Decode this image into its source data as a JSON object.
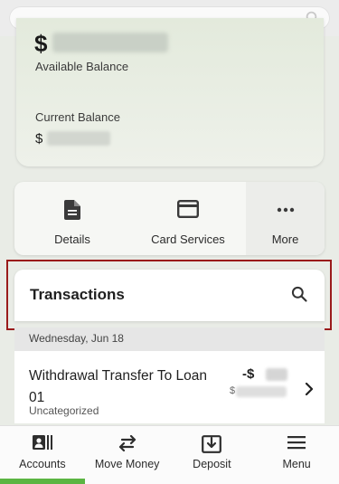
{
  "search": {
    "placeholder": ""
  },
  "balance": {
    "currency_symbol": "$",
    "available_label": "Available Balance",
    "current_label": "Current Balance",
    "current_currency_symbol": "$"
  },
  "actions": [
    {
      "label": "Details",
      "icon": "document-icon"
    },
    {
      "label": "Card Services",
      "icon": "credit-card-icon"
    },
    {
      "label": "More",
      "icon": "more-dots-icon"
    }
  ],
  "transactions": {
    "title": "Transactions",
    "date_header": "Wednesday, Jun 18",
    "items": [
      {
        "description": "Withdrawal Transfer To Loan 01",
        "category": "Uncategorized",
        "amount_prefix": "-$",
        "balance_prefix": "$"
      }
    ]
  },
  "bottom_nav": [
    {
      "label": "Accounts",
      "icon": "accounts-icon",
      "active": true
    },
    {
      "label": "Move Money",
      "icon": "transfer-arrows-icon",
      "active": false
    },
    {
      "label": "Deposit",
      "icon": "deposit-icon",
      "active": false
    },
    {
      "label": "Menu",
      "icon": "hamburger-menu-icon",
      "active": false
    }
  ],
  "colors": {
    "highlight_border": "#9a1b1b",
    "active_tab": "#5bb542"
  }
}
